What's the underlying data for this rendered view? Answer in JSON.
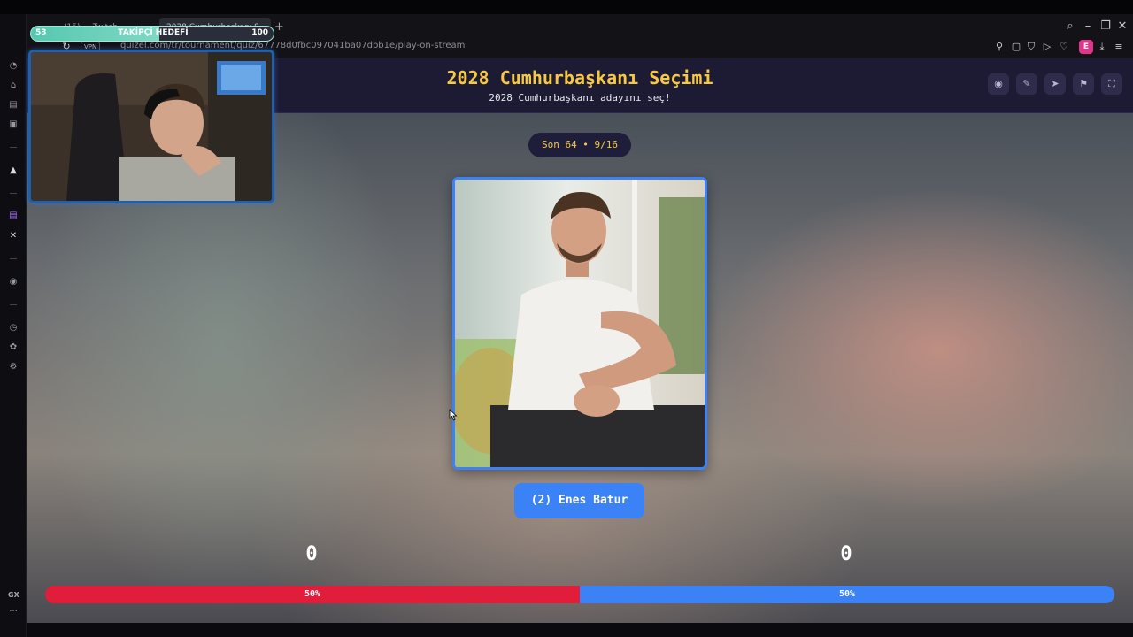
{
  "stream_overlay": {
    "goal_current": "53",
    "goal_label": "TAKİPÇİ HEDEFİ",
    "goal_target": "100",
    "goal_progress": 0.53
  },
  "browser": {
    "tabs": [
      {
        "label": "(15) ... Twitch"
      },
      {
        "label": "2028 Cumhurbaşkanı S..."
      }
    ],
    "new_tab": "+",
    "vpn_label": "VPN",
    "url": "quizel.com/tr/tournament/quiz/67778d0fbc097041ba07dbb1e/play-on-stream",
    "profile_initial": "E",
    "sidebar_gx": "GX",
    "sidebar_more": "···"
  },
  "page": {
    "title": "2028 Cumhurbaşkanı Seçimi",
    "subtitle": "2028 Cumhurbaşkanı adayını seç!",
    "round_label": "Son 64 • 9/16",
    "candidate_name": "(2) Enes Batur",
    "votes_left": "0",
    "votes_right": "0",
    "pct_left_label": "50%",
    "pct_right_label": "50%",
    "pct_left": 50,
    "pct_right": 50
  },
  "colors": {
    "title": "#f6c843",
    "accent_blue": "#3b82f6",
    "accent_red": "#e11d3c",
    "header_bg": "#1d1b33"
  }
}
